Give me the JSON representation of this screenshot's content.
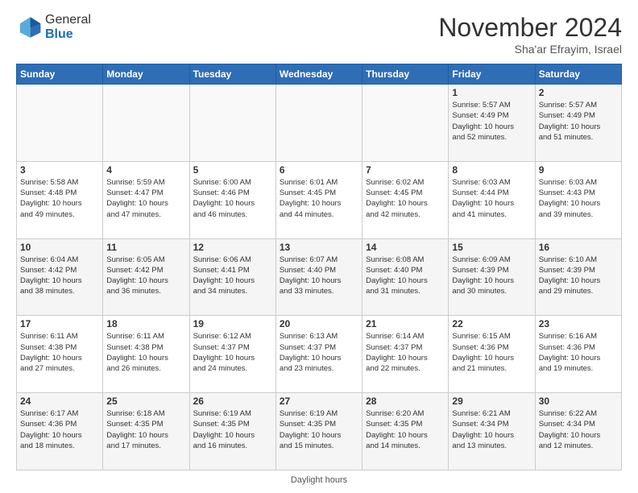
{
  "logo": {
    "general": "General",
    "blue": "Blue"
  },
  "title": "November 2024",
  "subtitle": "Sha'ar Efrayim, Israel",
  "days_header": [
    "Sunday",
    "Monday",
    "Tuesday",
    "Wednesday",
    "Thursday",
    "Friday",
    "Saturday"
  ],
  "weeks": [
    [
      {
        "day": "",
        "info": ""
      },
      {
        "day": "",
        "info": ""
      },
      {
        "day": "",
        "info": ""
      },
      {
        "day": "",
        "info": ""
      },
      {
        "day": "",
        "info": ""
      },
      {
        "day": "1",
        "info": "Sunrise: 5:57 AM\nSunset: 4:49 PM\nDaylight: 10 hours\nand 52 minutes."
      },
      {
        "day": "2",
        "info": "Sunrise: 5:57 AM\nSunset: 4:49 PM\nDaylight: 10 hours\nand 51 minutes."
      }
    ],
    [
      {
        "day": "3",
        "info": "Sunrise: 5:58 AM\nSunset: 4:48 PM\nDaylight: 10 hours\nand 49 minutes."
      },
      {
        "day": "4",
        "info": "Sunrise: 5:59 AM\nSunset: 4:47 PM\nDaylight: 10 hours\nand 47 minutes."
      },
      {
        "day": "5",
        "info": "Sunrise: 6:00 AM\nSunset: 4:46 PM\nDaylight: 10 hours\nand 46 minutes."
      },
      {
        "day": "6",
        "info": "Sunrise: 6:01 AM\nSunset: 4:45 PM\nDaylight: 10 hours\nand 44 minutes."
      },
      {
        "day": "7",
        "info": "Sunrise: 6:02 AM\nSunset: 4:45 PM\nDaylight: 10 hours\nand 42 minutes."
      },
      {
        "day": "8",
        "info": "Sunrise: 6:03 AM\nSunset: 4:44 PM\nDaylight: 10 hours\nand 41 minutes."
      },
      {
        "day": "9",
        "info": "Sunrise: 6:03 AM\nSunset: 4:43 PM\nDaylight: 10 hours\nand 39 minutes."
      }
    ],
    [
      {
        "day": "10",
        "info": "Sunrise: 6:04 AM\nSunset: 4:42 PM\nDaylight: 10 hours\nand 38 minutes."
      },
      {
        "day": "11",
        "info": "Sunrise: 6:05 AM\nSunset: 4:42 PM\nDaylight: 10 hours\nand 36 minutes."
      },
      {
        "day": "12",
        "info": "Sunrise: 6:06 AM\nSunset: 4:41 PM\nDaylight: 10 hours\nand 34 minutes."
      },
      {
        "day": "13",
        "info": "Sunrise: 6:07 AM\nSunset: 4:40 PM\nDaylight: 10 hours\nand 33 minutes."
      },
      {
        "day": "14",
        "info": "Sunrise: 6:08 AM\nSunset: 4:40 PM\nDaylight: 10 hours\nand 31 minutes."
      },
      {
        "day": "15",
        "info": "Sunrise: 6:09 AM\nSunset: 4:39 PM\nDaylight: 10 hours\nand 30 minutes."
      },
      {
        "day": "16",
        "info": "Sunrise: 6:10 AM\nSunset: 4:39 PM\nDaylight: 10 hours\nand 29 minutes."
      }
    ],
    [
      {
        "day": "17",
        "info": "Sunrise: 6:11 AM\nSunset: 4:38 PM\nDaylight: 10 hours\nand 27 minutes."
      },
      {
        "day": "18",
        "info": "Sunrise: 6:11 AM\nSunset: 4:38 PM\nDaylight: 10 hours\nand 26 minutes."
      },
      {
        "day": "19",
        "info": "Sunrise: 6:12 AM\nSunset: 4:37 PM\nDaylight: 10 hours\nand 24 minutes."
      },
      {
        "day": "20",
        "info": "Sunrise: 6:13 AM\nSunset: 4:37 PM\nDaylight: 10 hours\nand 23 minutes."
      },
      {
        "day": "21",
        "info": "Sunrise: 6:14 AM\nSunset: 4:37 PM\nDaylight: 10 hours\nand 22 minutes."
      },
      {
        "day": "22",
        "info": "Sunrise: 6:15 AM\nSunset: 4:36 PM\nDaylight: 10 hours\nand 21 minutes."
      },
      {
        "day": "23",
        "info": "Sunrise: 6:16 AM\nSunset: 4:36 PM\nDaylight: 10 hours\nand 19 minutes."
      }
    ],
    [
      {
        "day": "24",
        "info": "Sunrise: 6:17 AM\nSunset: 4:36 PM\nDaylight: 10 hours\nand 18 minutes."
      },
      {
        "day": "25",
        "info": "Sunrise: 6:18 AM\nSunset: 4:35 PM\nDaylight: 10 hours\nand 17 minutes."
      },
      {
        "day": "26",
        "info": "Sunrise: 6:19 AM\nSunset: 4:35 PM\nDaylight: 10 hours\nand 16 minutes."
      },
      {
        "day": "27",
        "info": "Sunrise: 6:19 AM\nSunset: 4:35 PM\nDaylight: 10 hours\nand 15 minutes."
      },
      {
        "day": "28",
        "info": "Sunrise: 6:20 AM\nSunset: 4:35 PM\nDaylight: 10 hours\nand 14 minutes."
      },
      {
        "day": "29",
        "info": "Sunrise: 6:21 AM\nSunset: 4:34 PM\nDaylight: 10 hours\nand 13 minutes."
      },
      {
        "day": "30",
        "info": "Sunrise: 6:22 AM\nSunset: 4:34 PM\nDaylight: 10 hours\nand 12 minutes."
      }
    ]
  ],
  "footer": "Daylight hours"
}
